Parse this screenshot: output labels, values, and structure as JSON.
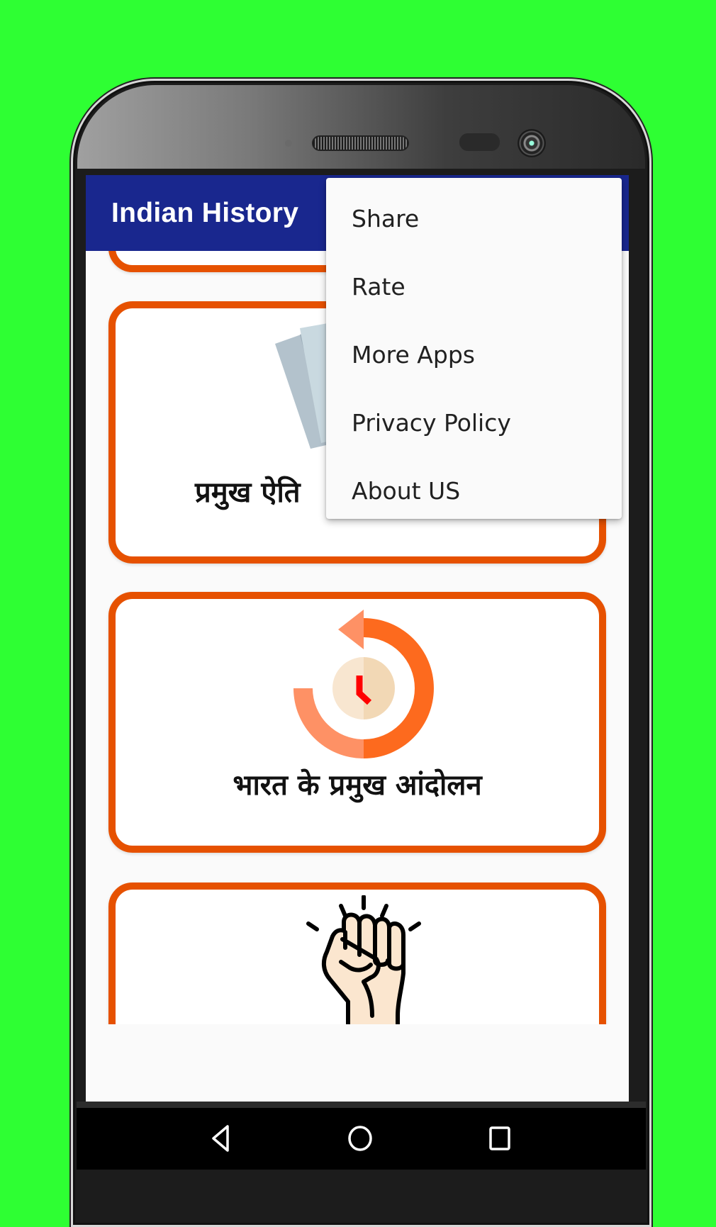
{
  "app": {
    "title": "Indian History",
    "colors": {
      "background_green": "#2eff33",
      "appbar": "#19278e",
      "card_border": "#e65100",
      "content_bg": "#fafafa"
    }
  },
  "overflow_menu": {
    "items": [
      {
        "label": "Share"
      },
      {
        "label": "Rate"
      },
      {
        "label": "More Apps"
      },
      {
        "label": "Privacy Policy"
      },
      {
        "label": "About US"
      }
    ]
  },
  "cards": [
    {
      "title": "",
      "icon": "unknown-icon"
    },
    {
      "title": "प्रमुख ऐति",
      "icon": "documents-icon"
    },
    {
      "title": "भारत के प्रमुख आंदोलन",
      "icon": "history-clock-icon"
    },
    {
      "title": "",
      "icon": "raised-fist-icon"
    }
  ],
  "navigation": {
    "back": "back-icon",
    "home": "home-icon",
    "recents": "recents-icon"
  }
}
